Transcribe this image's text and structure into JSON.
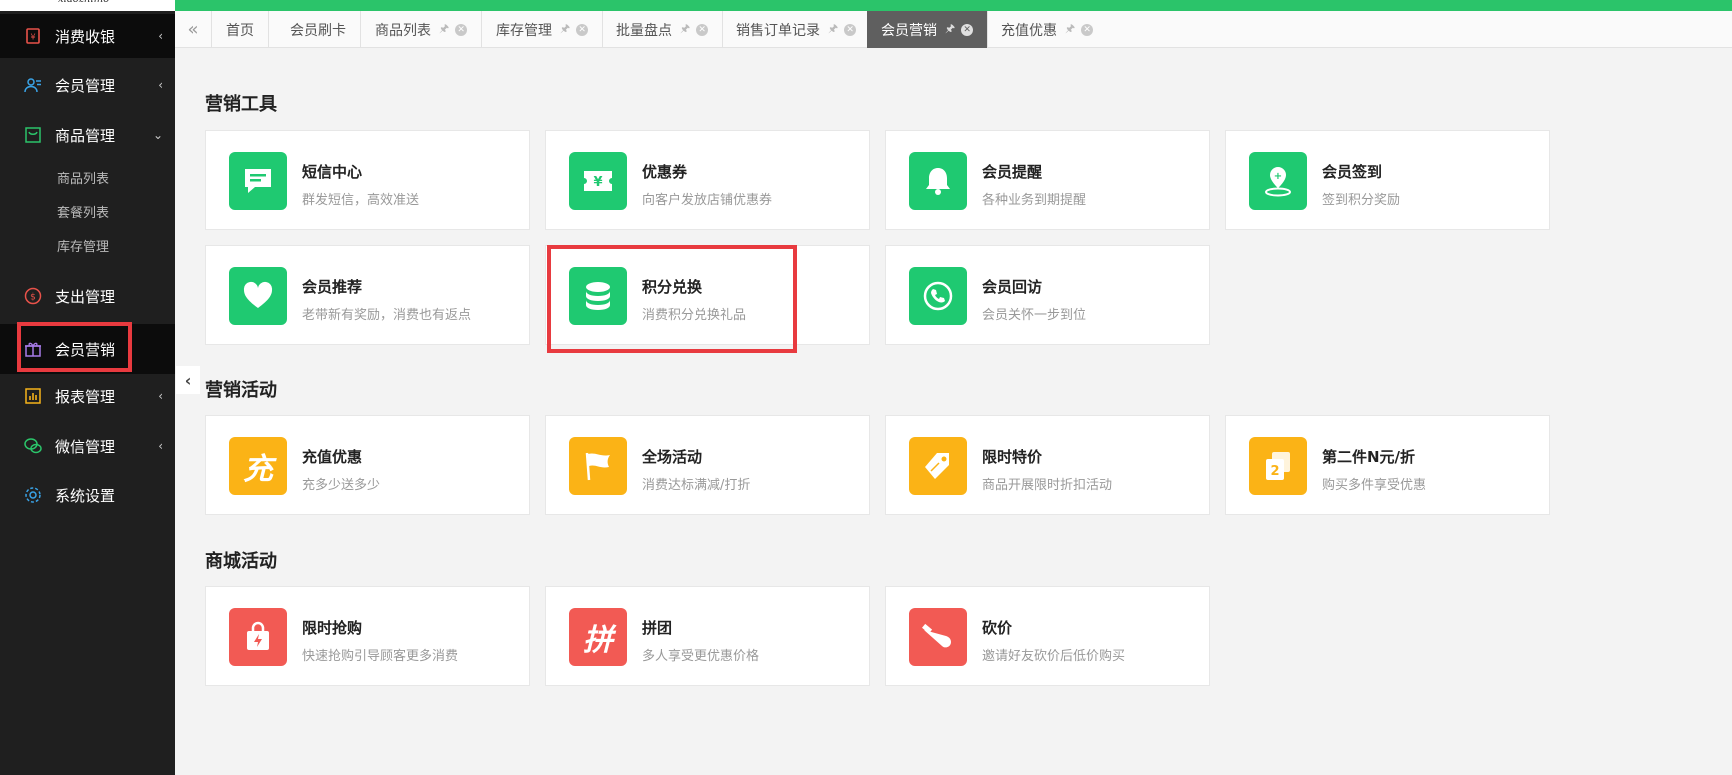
{
  "logo": {
    "text": "xiaozhimo"
  },
  "sidebar": {
    "items": [
      {
        "label": "消费收银",
        "arrow": "‹"
      },
      {
        "label": "会员管理",
        "arrow": "‹"
      },
      {
        "label": "商品管理",
        "arrow": "⌄"
      },
      {
        "label": "支出管理",
        "arrow": ""
      },
      {
        "label": "会员营销",
        "arrow": ""
      },
      {
        "label": "报表管理",
        "arrow": "‹"
      },
      {
        "label": "微信管理",
        "arrow": "‹"
      },
      {
        "label": "系统设置",
        "arrow": ""
      }
    ],
    "submenu": [
      "商品列表",
      "套餐列表",
      "库存管理"
    ]
  },
  "tabs": [
    "首页",
    "会员刷卡",
    "商品列表",
    "库存管理",
    "批量盘点",
    "销售订单记录",
    "会员营销",
    "充值优惠"
  ],
  "sections": {
    "tools": {
      "title": "营销工具",
      "cards": [
        {
          "title": "短信中心",
          "desc": "群发短信，高效准送"
        },
        {
          "title": "优惠券",
          "desc": "向客户发放店铺优惠券"
        },
        {
          "title": "会员提醒",
          "desc": "各种业务到期提醒"
        },
        {
          "title": "会员签到",
          "desc": "签到积分奖励"
        },
        {
          "title": "会员推荐",
          "desc": "老带新有奖励，消费也有返点"
        },
        {
          "title": "积分兑换",
          "desc": "消费积分兑换礼品"
        },
        {
          "title": "会员回访",
          "desc": "会员关怀一步到位"
        }
      ]
    },
    "activities": {
      "title": "营销活动",
      "cards": [
        {
          "title": "充值优惠",
          "desc": "充多少送多少",
          "glyph": "充"
        },
        {
          "title": "全场活动",
          "desc": "消费达标满减/打折"
        },
        {
          "title": "限时特价",
          "desc": "商品开展限时折扣活动"
        },
        {
          "title": "第二件N元/折",
          "desc": "购买多件享受优惠",
          "glyph": "2"
        }
      ]
    },
    "mall": {
      "title": "商城活动",
      "cards": [
        {
          "title": "限时抢购",
          "desc": "快速抢购引导顾客更多消费"
        },
        {
          "title": "拼团",
          "desc": "多人享受更优惠价格",
          "glyph": "拼"
        },
        {
          "title": "砍价",
          "desc": "邀请好友砍价后低价购买"
        }
      ]
    }
  },
  "colors": {
    "green": "#1fc971",
    "yellow": "#fbb316",
    "red": "#f25a54",
    "highlight": "#e83a3f",
    "topbar": "#2bc46a"
  }
}
